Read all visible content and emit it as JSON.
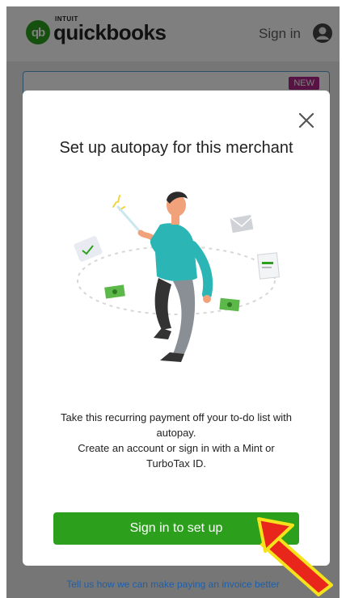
{
  "header": {
    "logo_small": "INTUIT",
    "logo_word": "quickbooks",
    "logo_mark": "qb",
    "signin_label": "Sign in",
    "account_icon": "user-avatar-icon"
  },
  "banner": {
    "badge": "NEW"
  },
  "modal": {
    "title": "Set up autopay for this merchant",
    "close_icon": "close-icon",
    "body_line1": "Take this recurring payment off your to-do list with autopay.",
    "body_line2": "Create an account or sign in with a Mint or TurboTax ID.",
    "primary_button": "Sign in to set up"
  },
  "footer": {
    "link": "Tell us how we can make paying an invoice better"
  },
  "colors": {
    "brand_green": "#2ca01c",
    "badge_magenta": "#b0278a",
    "link_blue": "#1f5fa8",
    "arrow_red": "#e8261c",
    "arrow_yellow": "#f6e21a"
  }
}
